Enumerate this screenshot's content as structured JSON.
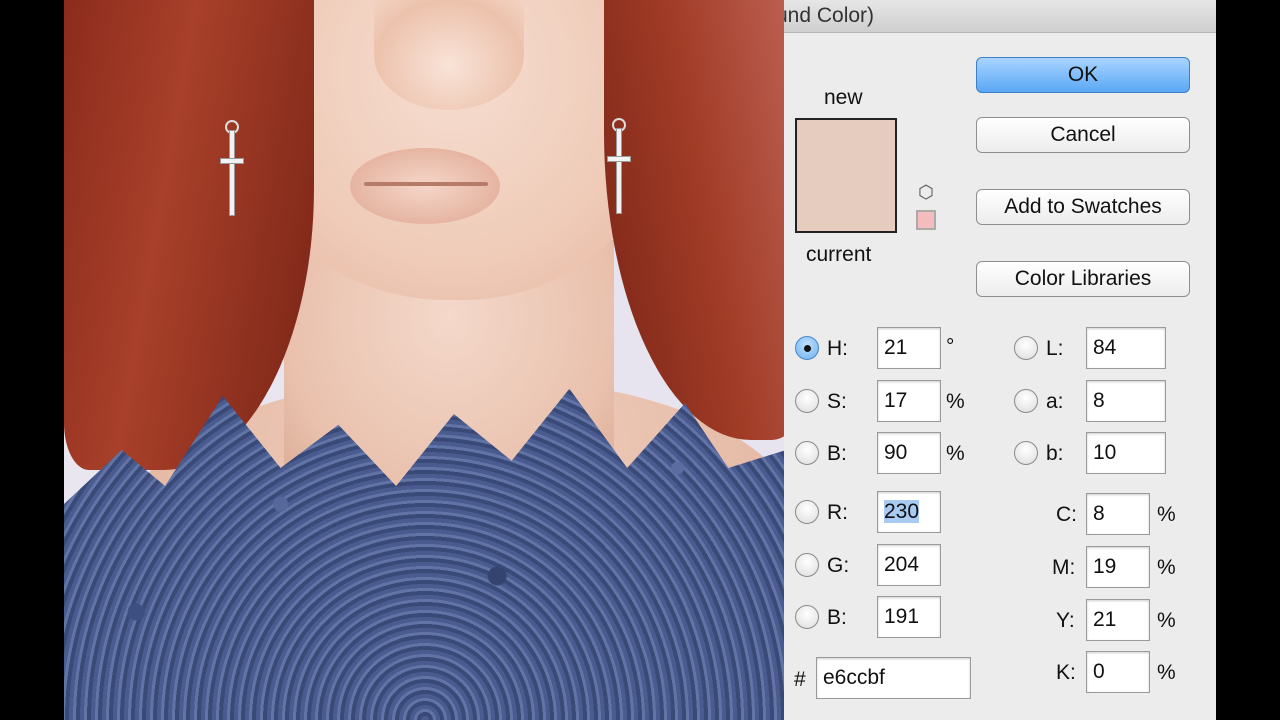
{
  "dialog": {
    "title_partial": "und Color)",
    "preview": {
      "new_label": "new",
      "current_label": "current",
      "new_color": "#e6ccbf"
    },
    "buttons": {
      "ok": "OK",
      "cancel": "Cancel",
      "add_to_swatches": "Add to Swatches",
      "color_libraries": "Color Libraries"
    },
    "hsb": {
      "h": {
        "label": "H:",
        "value": "21",
        "unit": "°",
        "selected": true
      },
      "s": {
        "label": "S:",
        "value": "17",
        "unit": "%"
      },
      "b": {
        "label": "B:",
        "value": "90",
        "unit": "%"
      }
    },
    "lab": {
      "l": {
        "label": "L:",
        "value": "84"
      },
      "a": {
        "label": "a:",
        "value": "8"
      },
      "b": {
        "label": "b:",
        "value": "10"
      }
    },
    "rgb": {
      "r": {
        "label": "R:",
        "value": "230"
      },
      "g": {
        "label": "G:",
        "value": "204"
      },
      "b": {
        "label": "B:",
        "value": "191"
      }
    },
    "cmyk": {
      "c": {
        "label": "C:",
        "value": "8",
        "unit": "%"
      },
      "m": {
        "label": "M:",
        "value": "19",
        "unit": "%"
      },
      "y": {
        "label": "Y:",
        "value": "21",
        "unit": "%"
      },
      "k": {
        "label": "K:",
        "value": "0",
        "unit": "%"
      }
    },
    "hex": {
      "label": "#",
      "value": "e6ccbf"
    },
    "icons": {
      "gamut_warning": "cube-icon",
      "web_safe": "websafe-swatch"
    }
  }
}
